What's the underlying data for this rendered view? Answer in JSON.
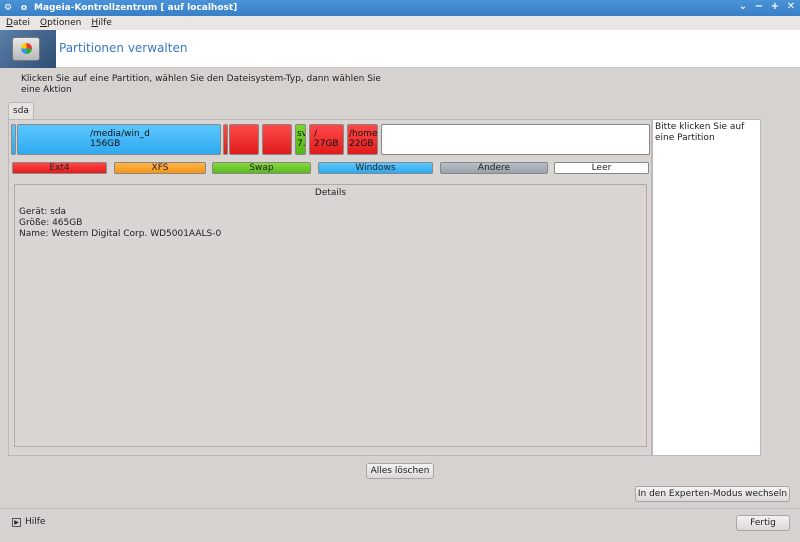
{
  "window": {
    "title": "Mageia-Kontrollzentrum  [ auf localhost]",
    "controls": [
      "⌄",
      "−",
      "+",
      "✕"
    ]
  },
  "menu": [
    "Datei",
    "Optionen",
    "Hilfe"
  ],
  "header": {
    "title": "Partitionen verwalten",
    "icon": "disk-partition-icon"
  },
  "instruction": "Klicken Sie auf eine Partition, wählen Sie den Dateisystem-Typ, dann wählen Sie eine Aktion",
  "tab": "sda",
  "partitions": [
    {
      "label": "",
      "size": "",
      "type": "Windows"
    },
    {
      "label": "/media/win_d",
      "size": "156GB",
      "type": "Windows"
    },
    {
      "label": "",
      "size": "",
      "type": "Ext4"
    },
    {
      "label": "",
      "size": "",
      "type": "Ext4"
    },
    {
      "label": "",
      "size": "",
      "type": "Ext4"
    },
    {
      "label": "sv",
      "size": "7.",
      "type": "Swap"
    },
    {
      "label": "/",
      "size": "27GB",
      "type": "Ext4"
    },
    {
      "label": "/home",
      "size": "22GB",
      "type": "Ext4"
    },
    {
      "label": "",
      "size": "",
      "type": "Leer"
    }
  ],
  "legend": {
    "ext4": {
      "label": "Ext4",
      "color": "#ff2a2a"
    },
    "xfs": {
      "label": "XFS",
      "color": "#ff9f1a"
    },
    "swap": {
      "label": "Swap",
      "color": "#66cc22"
    },
    "windows": {
      "label": "Windows",
      "color": "#3ab5f5"
    },
    "other": {
      "label": "Andere",
      "color": "#a8aeb5"
    },
    "empty": {
      "label": "Leer",
      "color": "#ffffff"
    }
  },
  "details": {
    "title": "Details",
    "device": "Gerät: sda",
    "size": "Größe: 465GB",
    "name": "Name: Western Digital Corp. WD5001AALS-0"
  },
  "side_hint": "Bitte klicken Sie auf eine Partition",
  "buttons": {
    "delete_all": "Alles löschen",
    "expert_mode": "In den Experten-Modus wechseln",
    "done": "Fertig"
  },
  "help": {
    "label": "Hilfe",
    "icon": "expand-triangle-icon"
  }
}
